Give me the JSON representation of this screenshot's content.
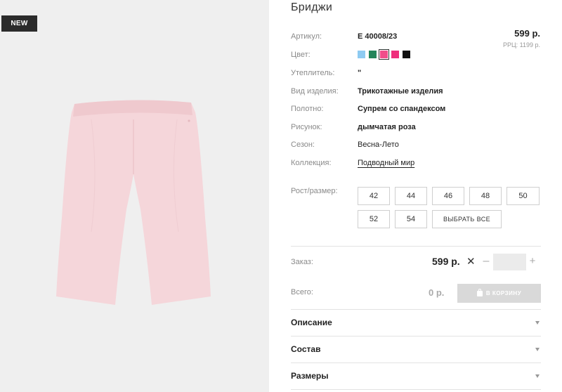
{
  "badge": "NEW",
  "product": {
    "title": "Бриджи",
    "price": "599 р.",
    "rrp": "РРЦ: 1199 р.",
    "attributes": [
      {
        "label": "Артикул:",
        "value": "Е 40008/23"
      },
      {
        "label": "Цвет:",
        "value": ""
      },
      {
        "label": "Утеплитель:",
        "value": "\""
      },
      {
        "label": "Вид изделия:",
        "value": "Трикотажные изделия"
      },
      {
        "label": "Полотно:",
        "value": "Супрем со спандексом"
      },
      {
        "label": "Рисунок:",
        "value": "дымчатая роза"
      },
      {
        "label": "Сезон:",
        "value": "Весна-Лето"
      },
      {
        "label": "Коллекция:",
        "value": "Подводный мир"
      }
    ],
    "colors": [
      "#8ecbf2",
      "#24855a",
      "#f14d8a",
      "#ef2f7c",
      "#111111"
    ],
    "selected_color_index": 2,
    "image_color": "#f5d6da"
  },
  "sizes": {
    "label": "Рост/размер:",
    "options": [
      "42",
      "44",
      "46",
      "48",
      "50",
      "52",
      "54"
    ],
    "select_all": "ВЫБРАТЬ ВСЕ"
  },
  "order": {
    "label": "Заказ:",
    "price": "599 р.",
    "times": "✕",
    "minus": "–",
    "plus": "+",
    "quantity": ""
  },
  "total": {
    "label": "Всего:",
    "value": "0 р.",
    "cart_button": "В КОРЗИНУ"
  },
  "accordions": [
    "Описание",
    "Состав",
    "Размеры"
  ]
}
